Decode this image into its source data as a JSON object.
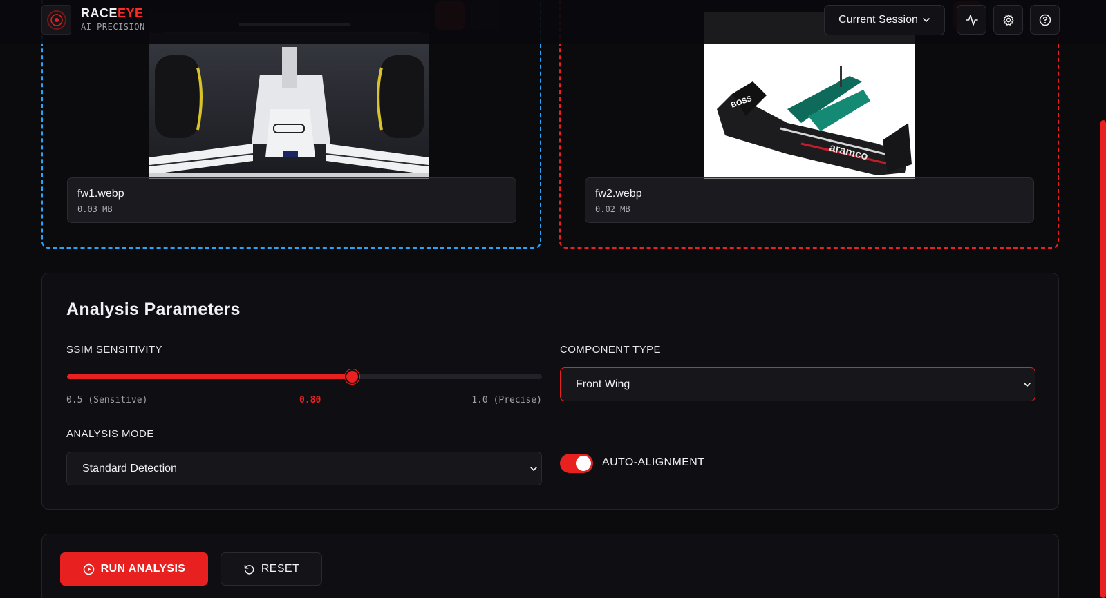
{
  "header": {
    "brand_primary": "RACE",
    "brand_accent": "EYE",
    "brand_subtitle": "AI PRECISION",
    "session_label": "Current Session",
    "icons": [
      "activity-icon",
      "gear-icon",
      "help-icon"
    ]
  },
  "uploads": [
    {
      "file_name": "fw1.webp",
      "file_size": "0.03 MB",
      "border_color": "#27a4f5"
    },
    {
      "file_name": "fw2.webp",
      "file_size": "0.02 MB",
      "border_color": "#e8201f"
    }
  ],
  "parameters": {
    "title": "Analysis Parameters",
    "ssim": {
      "label": "SSIM SENSITIVITY",
      "min_label": "0.5 (Sensitive)",
      "max_label": "1.0 (Precise)",
      "value_label": "0.80",
      "value": 0.8,
      "min": 0.5,
      "max": 1.0
    },
    "component_type": {
      "label": "COMPONENT TYPE",
      "selected": "Front Wing"
    },
    "analysis_mode": {
      "label": "ANALYSIS MODE",
      "selected": "Standard Detection"
    },
    "auto_alignment": {
      "label": "AUTO-ALIGNMENT",
      "enabled": true
    }
  },
  "actions": {
    "run_label": "RUN ANALYSIS",
    "reset_label": "RESET"
  },
  "colors": {
    "accent": "#e8201f",
    "secondary": "#27a4f5",
    "background": "#0b0b0e"
  }
}
